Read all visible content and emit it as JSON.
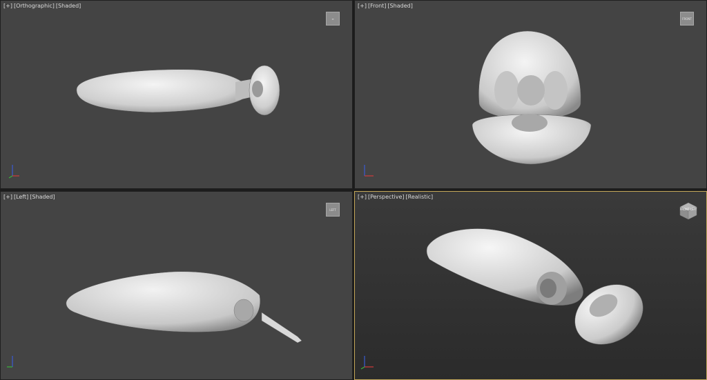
{
  "viewports": [
    {
      "id": "top-left",
      "label": {
        "plus": "[+]",
        "view": "[Orthographic]",
        "shading": "[Shaded]"
      },
      "viewcube_icon": "viewcube-icon",
      "active": false
    },
    {
      "id": "top-right",
      "label": {
        "plus": "[+]",
        "view": "[Front]",
        "shading": "[Shaded]"
      },
      "viewcube_icon": "viewcube-icon",
      "viewcube_text": "FRONT",
      "active": false
    },
    {
      "id": "bottom-left",
      "label": {
        "plus": "[+]",
        "view": "[Left]",
        "shading": "[Shaded]"
      },
      "viewcube_icon": "viewcube-icon",
      "viewcube_text": "LEFT",
      "active": false
    },
    {
      "id": "bottom-right",
      "label": {
        "plus": "[+]",
        "view": "[Perspective]",
        "shading": "[Realistic]"
      },
      "viewcube_icon": "viewcube-icon",
      "viewcube_text": "FRONT LEFT",
      "active": true
    }
  ],
  "colors": {
    "viewport_bg": "#444444",
    "active_border": "#c6a95a",
    "label_text": "#dadada",
    "model": "#e6e6e6",
    "axis_x": "#d23a3a",
    "axis_y": "#3ab53a",
    "axis_z": "#3a5ad2"
  },
  "icons": [
    "viewcube-icon",
    "axis-tripod-icon",
    "fishing-lure-model"
  ]
}
